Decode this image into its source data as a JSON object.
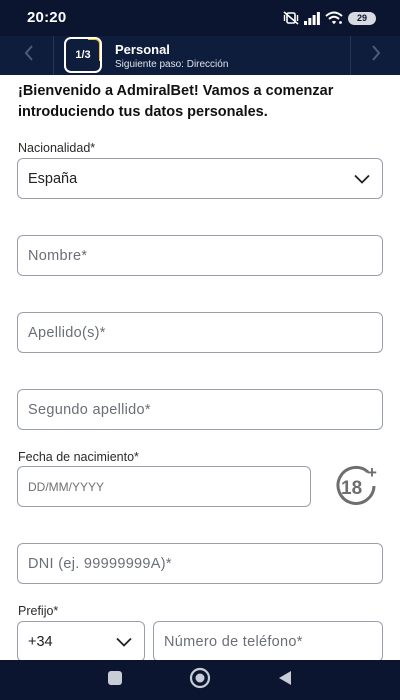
{
  "status_bar": {
    "time": "20:20",
    "battery_level": "29",
    "icons": [
      "mute-vibrate-icon",
      "signal-icon",
      "wifi-icon",
      "battery-icon"
    ]
  },
  "header": {
    "step_indicator": "1/3",
    "title": "Personal",
    "subtitle": "Siguiente paso: Dirección",
    "accent_color": "#f2c500",
    "background_color": "#0f1d3d"
  },
  "form": {
    "welcome_text": "¡Bienvenido a AdmiralBet! Vamos a comenzar introduciendo tus datos personales.",
    "nationality": {
      "label": "Nacionalidad*",
      "value": "España"
    },
    "first_name": {
      "placeholder": "Nombre*"
    },
    "last_name": {
      "placeholder": "Apellido(s)*"
    },
    "second_last_name": {
      "placeholder": "Segundo apellido*"
    },
    "birth_date": {
      "label": "Fecha de nacimiento*",
      "placeholder": "DD/MM/YYYY"
    },
    "age_badge": {
      "text": "18",
      "plus": "+"
    },
    "dni": {
      "placeholder": "DNI (ej. 99999999A)*"
    },
    "prefix": {
      "label": "Prefijo*",
      "value": "+34"
    },
    "phone": {
      "placeholder": "Número de teléfono*"
    }
  },
  "system_nav": {
    "icons": [
      "recents-icon",
      "home-icon",
      "back-icon"
    ]
  }
}
